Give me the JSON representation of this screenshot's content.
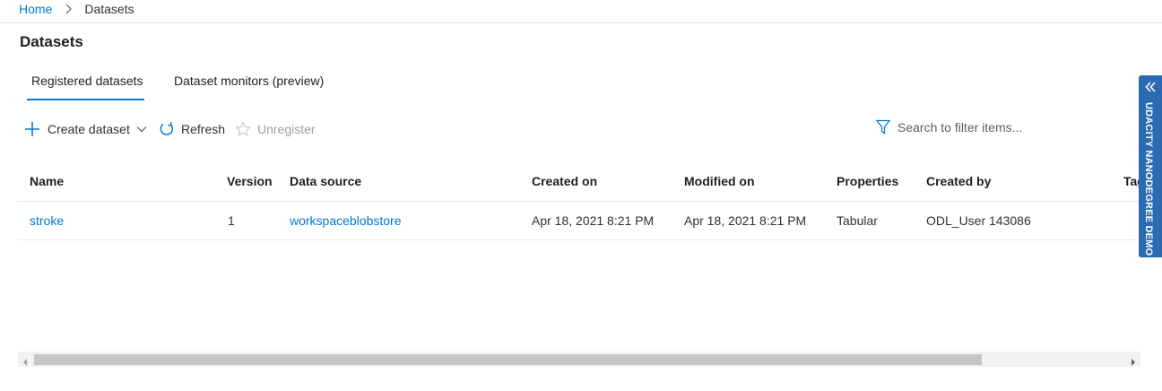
{
  "breadcrumb": {
    "home": "Home",
    "current": "Datasets"
  },
  "page": {
    "title": "Datasets"
  },
  "tabs": [
    {
      "label": "Registered datasets",
      "active": true
    },
    {
      "label": "Dataset monitors (preview)",
      "active": false
    }
  ],
  "toolbar": {
    "create_label": "Create dataset",
    "refresh_label": "Refresh",
    "unregister_label": "Unregister",
    "search_placeholder": "Search to filter items..."
  },
  "table": {
    "columns": [
      "Name",
      "Version",
      "Data source",
      "Created on",
      "Modified on",
      "Properties",
      "Created by",
      "Tag"
    ],
    "rows": [
      {
        "name": "stroke",
        "version": "1",
        "data_source": "workspaceblobstore",
        "created_on": "Apr 18, 2021 8:21 PM",
        "modified_on": "Apr 18, 2021 8:21 PM",
        "properties": "Tabular",
        "created_by": "ODL_User 143086"
      }
    ]
  },
  "side_panel": {
    "label": "UDACITY NANODEGREE DEMO"
  },
  "colors": {
    "accent": "#0078d4",
    "ribbon": "#2b6bb1",
    "disabled": "#a19f9d"
  },
  "icons": [
    "chevron-right-icon",
    "plus-icon",
    "chevron-down-icon",
    "refresh-icon",
    "star-icon",
    "filter-icon",
    "double-chevron-left-icon",
    "scroll-left-icon",
    "scroll-right-icon"
  ]
}
